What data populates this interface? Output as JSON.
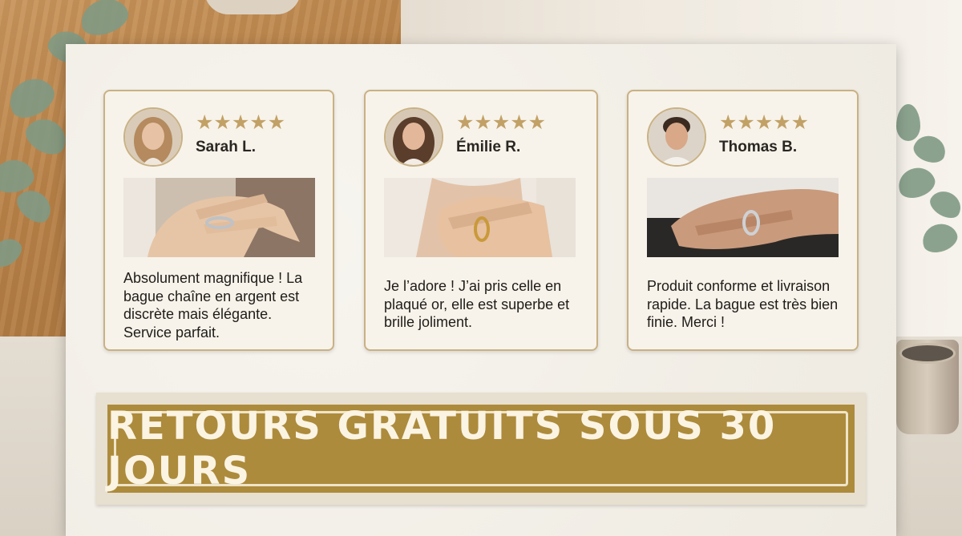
{
  "reviews": [
    {
      "name": "Sarah L.",
      "stars": "★★★★★",
      "text": "Absolument magnifique ! La bague chaîne en argent est discrète mais élégante. Service parfait.",
      "ring_color": "silver"
    },
    {
      "name": "Émilie R.",
      "stars": "★★★★★",
      "text": "Je l’adore ! J’ai pris celle en plaqué or, elle est superbe et brille joliment.",
      "ring_color": "gold"
    },
    {
      "name": "Thomas B.",
      "stars": "★★★★★",
      "text": "Produit conforme et livraison rapide. La bague est très bien finie. Merci !",
      "ring_color": "silver"
    }
  ],
  "banner": {
    "text": "RETOURS GRATUITS SOUS 30 JOURS"
  },
  "colors": {
    "accent": "#c2a166",
    "banner": "#ad8b3c",
    "paper": "#f3efe6"
  }
}
